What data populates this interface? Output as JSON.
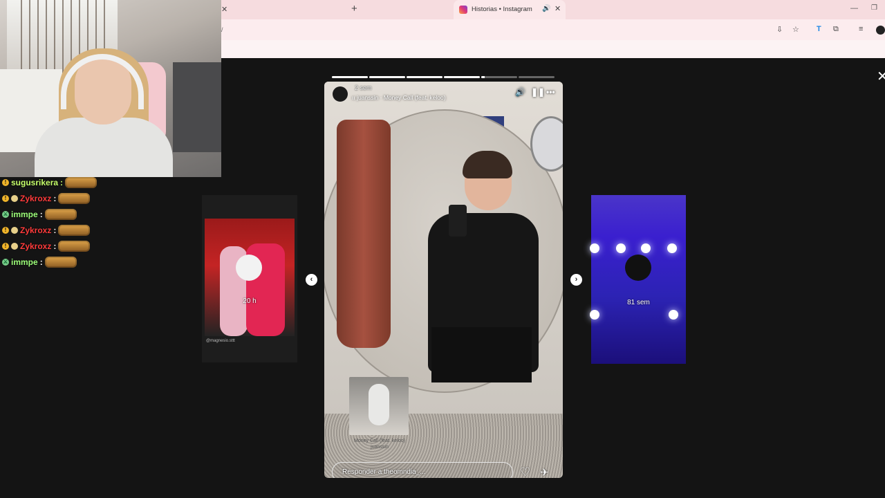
{
  "browser": {
    "tab_title": "Historias • Instagram",
    "url": "/",
    "icons": [
      "instagram-favicon",
      "speaker-icon",
      "close-icon",
      "plus-icon",
      "install-icon",
      "star-icon",
      "translate-icon",
      "extension-icon",
      "playlist-icon",
      "profile-icon"
    ]
  },
  "chat": {
    "messages": [
      {
        "user": "sugusrikera",
        "color": "#c6ff6b",
        "badges": [
          "gold"
        ]
      },
      {
        "user": "Zykroxz",
        "color": "#ff3b3b",
        "badges": [
          "gold",
          "crown"
        ]
      },
      {
        "user": "immpe",
        "color": "#9dff7a",
        "badges": [
          "sword"
        ]
      },
      {
        "user": "Zykroxz",
        "color": "#ff3b3b",
        "badges": [
          "gold",
          "crown"
        ]
      },
      {
        "user": "Zykroxz",
        "color": "#ff3b3b",
        "badges": [
          "gold",
          "crown"
        ]
      },
      {
        "user": "immpe",
        "color": "#9dff7a",
        "badges": [
          "sword"
        ]
      }
    ]
  },
  "story": {
    "time": "2 sem",
    "music": "ıı juanssin · Money Call (feat. keloo)",
    "segments": [
      1,
      1,
      1,
      1,
      0.1,
      0
    ],
    "sticker_caption": "Money Call (feat. keloo)",
    "sticker_artist": "juanssin",
    "reply_placeholder": "Responder a theomndia_..."
  },
  "prev_story": {
    "time": "20 h",
    "username": "@magnesio.sttt"
  },
  "next_story": {
    "time": "81 sem"
  }
}
